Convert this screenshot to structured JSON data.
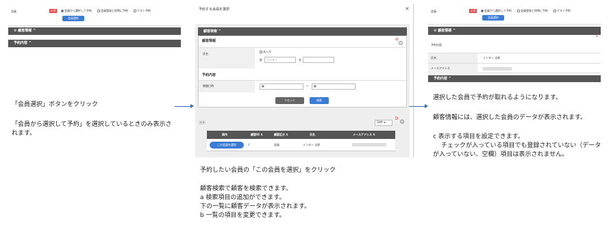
{
  "left": {
    "member_label": "会員",
    "required_badge": "必須",
    "radio1": "会員から選択して予約",
    "radio2": "会員登録と同時に予約",
    "radio3": "ゲスト予約",
    "select_button": "会員選択",
    "customer_info": "顧客情報",
    "booking_content": "予約内容",
    "note1": "「会員選択」ボタンをクリック",
    "note2": "「会員から選択して予約」を選択しているときのみ表示されます。"
  },
  "modal": {
    "title": "予約する会員を選択",
    "close": "×",
    "search_header": "顧客検索",
    "customer_info": "顧客情報",
    "name_label": "氏名",
    "unentered": "未入力",
    "sei": "姓",
    "sei_placeholder": "インター",
    "mei": "名",
    "booking_content": "予約内容",
    "period_label": "期間日時",
    "period_sep": "〜",
    "reset": "リセット",
    "search": "検索",
    "count_select": "30件",
    "marker_a": "a",
    "marker_b": "b",
    "pager": "« »",
    "columns": [
      "操作",
      "顧客ID",
      "顧客区分",
      "氏名",
      "メールアドレス"
    ],
    "row": {
      "button": "この会員を選択",
      "id": "6",
      "type": "会員",
      "name": "インター 太郎"
    },
    "note_main": "予約したい会員の「この会員を選択」をクリック",
    "note_lines": [
      "顧客検索で顧客を検索できます。",
      "a 検索項目の追加ができます。",
      "下の一覧に顧客データが表示されます。",
      "b 一覧の項目を変更できます。"
    ]
  },
  "right": {
    "member_label": "会員",
    "required_badge": "必須",
    "radio1": "会員から選択して予約",
    "radio2": "会員登録と同時に予約",
    "radio3": "ゲスト予約",
    "select_button": "会員選択",
    "customer_info": "顧客情報",
    "booking_content": "予約内容",
    "marker_c": "c",
    "name_label": "氏名",
    "name_value": "インター 太郎",
    "email_label": "メールアドレス",
    "note1": "選択した会員で予約が取れるようになります。",
    "note2": "顧客情報には、選択した会員のデータが表示されます。",
    "note3": "c 表示する項目を設定できます。",
    "note4": "チェックが入っている項目でも登録されていない（データが入っていない、空欄）項目は表示されません。"
  }
}
